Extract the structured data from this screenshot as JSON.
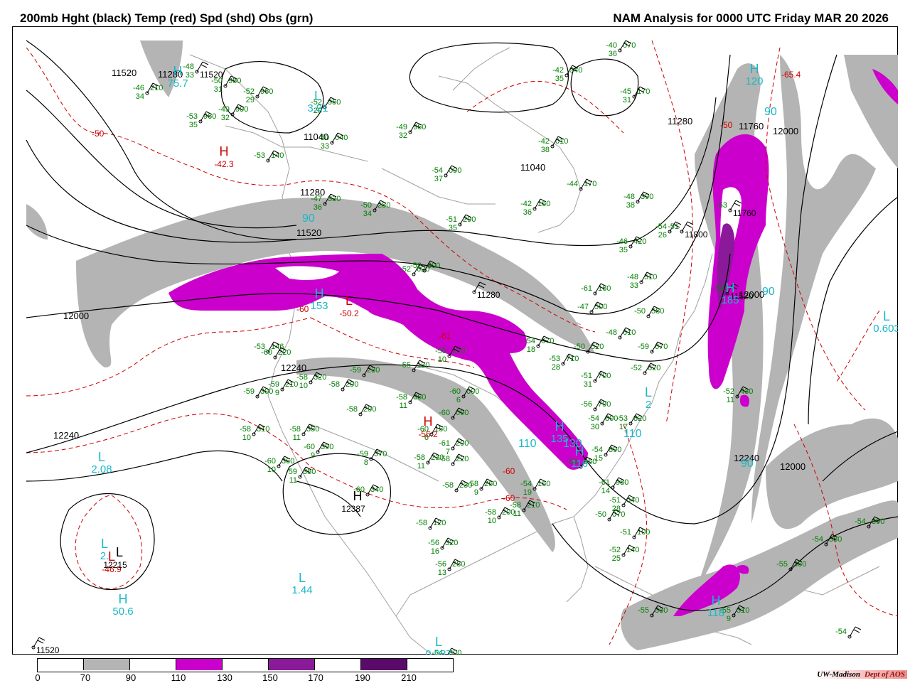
{
  "header": {
    "left_title": "200mb Hght (black) Temp (red) Spd (shd) Obs (grn)",
    "right_title": "NAM Analysis for 0000 UTC Friday  MAR 20 2026"
  },
  "colors": {
    "height": "#000000",
    "temp": "#cc0000",
    "obs": "#008000",
    "center_label": "#19b8c8",
    "land": "#9a9a9a",
    "speed_70_90": "#b4b4b4",
    "speed_110_130": "#cc00cc",
    "speed_150_170": "#8a1a9a",
    "speed_190_210": "#5a0a6a"
  },
  "height_contour_labels": [
    "11520",
    "11280",
    "11040",
    "11280",
    "11520",
    "11040",
    "11280",
    "11760",
    "12000",
    "12000",
    "12000",
    "12240",
    "12240",
    "12000",
    "12240"
  ],
  "temp_labels": [
    "-50",
    "-60",
    "-61",
    "-60",
    "-65.4",
    "-50",
    "-60"
  ],
  "centers": [
    {
      "letter": "H",
      "value": "75.7",
      "type": "speed"
    },
    {
      "letter": "L",
      "value": "3.91",
      "type": "speed"
    },
    {
      "letter": "H",
      "value": "-42.3",
      "type": "temp"
    },
    {
      "letter": "L",
      "value": "-50.2",
      "type": "temp"
    },
    {
      "letter": "H",
      "value": "-56.2",
      "type": "temp"
    },
    {
      "letter": "H",
      "value": "153",
      "type": "speed"
    },
    {
      "letter": "H",
      "value": "135",
      "type": "speed"
    },
    {
      "letter": "H",
      "value": "185",
      "type": "speed"
    },
    {
      "letter": "L",
      "value": "0.603",
      "type": "speed"
    },
    {
      "letter": "L",
      "value": "2.08",
      "type": "speed"
    },
    {
      "letter": "L",
      "value": "2.",
      "type": "speed"
    },
    {
      "letter": "L",
      "value": "-46.9",
      "type": "temp"
    },
    {
      "letter": "H",
      "value": "50.6",
      "type": "speed"
    },
    {
      "letter": "L",
      "value": "1.44",
      "type": "speed"
    },
    {
      "letter": "H",
      "value": "12387",
      "type": "height"
    },
    {
      "letter": "L",
      "value": "12215",
      "type": "height"
    },
    {
      "letter": "L",
      "value": "0.987",
      "type": "speed"
    },
    {
      "letter": "H",
      "value": "118",
      "type": "speed"
    },
    {
      "letter": "L",
      "value": "2",
      "type": "speed"
    },
    {
      "letter": "H",
      "value": "120",
      "type": "speed"
    },
    {
      "letter": "H",
      "value": "116",
      "type": "speed"
    }
  ],
  "speed_labels": [
    "90",
    "90",
    "90",
    "90",
    "110",
    "130",
    "110"
  ],
  "observations": [
    {
      "t": "-48",
      "d": "33",
      "h": "",
      "f": "11520"
    },
    {
      "t": "-50",
      "d": "31",
      "h": "980",
      "f": ""
    },
    {
      "t": "-52",
      "d": "29",
      "h": "960",
      "f": ""
    },
    {
      "t": "-46",
      "d": "34",
      "h": "210",
      "f": ""
    },
    {
      "t": "-49",
      "d": "32",
      "h": "990",
      "f": ""
    },
    {
      "t": "-53",
      "d": "35",
      "h": "960",
      "f": ""
    },
    {
      "t": "-52",
      "d": "29",
      "h": "950",
      "f": ""
    },
    {
      "t": "-49",
      "d": "32",
      "h": "960",
      "f": ""
    },
    {
      "t": "-50",
      "d": "33",
      "h": "040",
      "f": ""
    },
    {
      "t": "-53",
      "d": "",
      "h": "140",
      "f": ""
    },
    {
      "t": "-54",
      "d": "37",
      "h": "090",
      "f": ""
    },
    {
      "t": "-47",
      "d": "36",
      "h": "330",
      "f": ""
    },
    {
      "t": "-50",
      "d": "34",
      "h": "280",
      "f": ""
    },
    {
      "t": "-51",
      "d": "35",
      "h": "290",
      "f": ""
    },
    {
      "t": "-42",
      "d": "38",
      "h": "010",
      "f": ""
    },
    {
      "t": "-44",
      "d": "",
      "h": "170",
      "f": ""
    },
    {
      "t": "-42",
      "d": "36",
      "h": "160",
      "f": ""
    },
    {
      "t": "-40",
      "d": "36",
      "h": "070",
      "f": ""
    },
    {
      "t": "-42",
      "d": "35",
      "h": "940",
      "f": ""
    },
    {
      "t": "-45",
      "d": "31",
      "h": "170",
      "f": ""
    },
    {
      "t": "-48",
      "d": "38",
      "h": "390",
      "f": ""
    },
    {
      "t": "-46",
      "d": "35",
      "h": "420",
      "f": ""
    },
    {
      "t": "-54",
      "d": "26",
      "h": "",
      "f": ""
    },
    {
      "t": "-48",
      "d": "33",
      "h": "510",
      "f": ""
    },
    {
      "t": "-47",
      "d": "",
      "h": "500",
      "f": ""
    },
    {
      "t": "-50",
      "d": "",
      "h": "580",
      "f": ""
    },
    {
      "t": "-48",
      "d": "",
      "h": "610",
      "f": ""
    },
    {
      "t": "-50",
      "d": "",
      "h": "520",
      "f": ""
    },
    {
      "t": "-59",
      "d": "",
      "h": "670",
      "f": ""
    },
    {
      "t": "-52",
      "d": "",
      "h": "620",
      "f": ""
    },
    {
      "t": "-54",
      "d": "18",
      "h": "670",
      "f": ""
    },
    {
      "t": "-53",
      "d": "28",
      "h": "710",
      "f": ""
    },
    {
      "t": "-51",
      "d": "31",
      "h": "700",
      "f": ""
    },
    {
      "t": "-56",
      "d": "",
      "h": "790",
      "f": ""
    },
    {
      "t": "-54",
      "d": "30",
      "h": "800",
      "f": ""
    },
    {
      "t": "-53",
      "d": "17",
      "h": "820",
      "f": ""
    },
    {
      "t": "-54",
      "d": "15",
      "h": "890",
      "f": ""
    },
    {
      "t": "-52",
      "d": "",
      "h": "950",
      "f": ""
    },
    {
      "t": "-61",
      "d": "14",
      "h": "980",
      "f": ""
    },
    {
      "t": "-51",
      "d": "28",
      "h": "040",
      "f": ""
    },
    {
      "t": "-50",
      "d": "",
      "h": "070",
      "f": ""
    },
    {
      "t": "-51",
      "d": "",
      "h": "100",
      "f": ""
    },
    {
      "t": "-52",
      "d": "25",
      "h": "140",
      "f": ""
    },
    {
      "t": "-52",
      "d": "",
      "h": "620",
      "f": ""
    },
    {
      "t": "-52",
      "d": "",
      "h": "600",
      "f": ""
    },
    {
      "t": "-55",
      "d": "",
      "h": "130",
      "f": ""
    },
    {
      "t": "-53",
      "d": "",
      "h": "146",
      "f": ""
    },
    {
      "t": "-60",
      "d": "",
      "h": "220",
      "f": ""
    },
    {
      "t": "-59",
      "d": "",
      "h": "230",
      "f": ""
    },
    {
      "t": "-59",
      "d": "9",
      "h": "210",
      "f": ""
    },
    {
      "t": "-59",
      "d": "",
      "h": "300",
      "f": ""
    },
    {
      "t": "-58",
      "d": "10",
      "h": "320",
      "f": ""
    },
    {
      "t": "-58",
      "d": "",
      "h": "290",
      "f": ""
    },
    {
      "t": "-58",
      "d": "",
      "h": "290",
      "f": ""
    },
    {
      "t": "-58",
      "d": "10",
      "h": "310",
      "f": ""
    },
    {
      "t": "-58",
      "d": "11",
      "h": "350",
      "f": ""
    },
    {
      "t": "-60",
      "d": "10",
      "h": "360",
      "f": ""
    },
    {
      "t": "-59",
      "d": "11",
      "h": "380",
      "f": ""
    },
    {
      "t": "-60",
      "d": "9",
      "h": "390",
      "f": ""
    },
    {
      "t": "-59",
      "d": "8",
      "h": "370",
      "f": ""
    },
    {
      "t": "-60",
      "d": "",
      "h": "340",
      "f": ""
    },
    {
      "t": "-58",
      "d": "11",
      "h": "360",
      "f": ""
    },
    {
      "t": "-55",
      "d": "10",
      "h": "170",
      "f": ""
    },
    {
      "t": "-60",
      "d": "6",
      "h": "000",
      "f": ""
    },
    {
      "t": "-60",
      "d": "",
      "h": "090",
      "f": ""
    },
    {
      "t": "-60",
      "d": "6",
      "h": "150",
      "f": ""
    },
    {
      "t": "-58",
      "d": "11",
      "h": "230",
      "f": ""
    },
    {
      "t": "-61",
      "d": "7",
      "h": "290",
      "f": ""
    },
    {
      "t": "-58",
      "d": "",
      "h": "220",
      "f": ""
    },
    {
      "t": "-58",
      "d": "",
      "h": "230",
      "f": ""
    },
    {
      "t": "-58",
      "d": "9",
      "h": "260",
      "f": ""
    },
    {
      "t": "-58",
      "d": "10",
      "h": "200",
      "f": ""
    },
    {
      "t": "-58",
      "d": "11",
      "h": "210",
      "f": ""
    },
    {
      "t": "-54",
      "d": "19",
      "h": "160",
      "f": ""
    },
    {
      "t": "-58",
      "d": "",
      "h": "120",
      "f": ""
    },
    {
      "t": "-56",
      "d": "16",
      "h": "320",
      "f": ""
    },
    {
      "t": "-56",
      "d": "13",
      "h": "280",
      "f": ""
    },
    {
      "t": "-54",
      "d": "18",
      "h": "300",
      "f": ""
    },
    {
      "t": "-55",
      "d": "",
      "h": "330",
      "f": ""
    },
    {
      "t": "-55",
      "d": "9",
      "h": "310",
      "f": ""
    },
    {
      "t": "-55",
      "d": "",
      "h": "350",
      "f": ""
    },
    {
      "t": "-54",
      "d": "",
      "h": "380",
      "f": ""
    },
    {
      "t": "-54",
      "d": "",
      "h": "390",
      "f": ""
    },
    {
      "t": "-54",
      "d": "",
      "h": "",
      "f": ""
    },
    {
      "t": "-52",
      "d": "11",
      "h": "430",
      "f": ""
    },
    {
      "t": "-61",
      "d": "",
      "h": "160",
      "f": ""
    },
    {
      "t": "-51",
      "d": "",
      "h": "",
      "f": "11800"
    },
    {
      "t": "-54",
      "d": "",
      "h": "",
      "f": "11520"
    },
    {
      "t": "",
      "d": "",
      "h": "",
      "f": "11280"
    },
    {
      "t": "-53",
      "d": "",
      "h": "",
      "f": "11760"
    },
    {
      "t": "",
      "d": "",
      "h": "",
      "f": "11520"
    }
  ],
  "legend": {
    "ticks": [
      "0",
      "70",
      "90",
      "110",
      "130",
      "150",
      "170",
      "190",
      "210"
    ]
  },
  "credit": {
    "left": "UW-Madison",
    "right": "Dept of AOS"
  }
}
